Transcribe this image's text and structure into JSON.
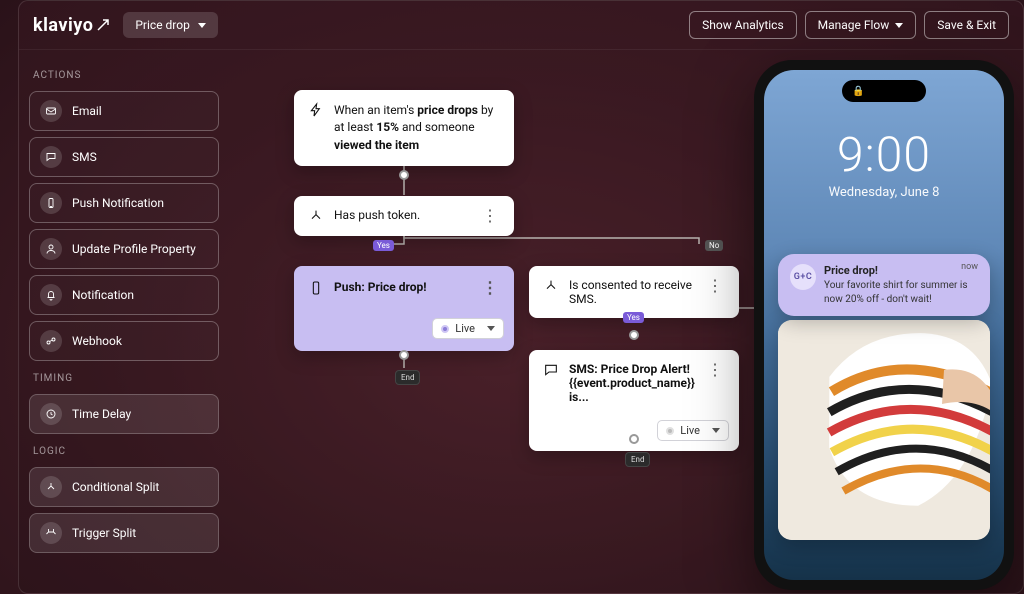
{
  "brand": "klaviyo",
  "flow_picker": {
    "label": "Price drop"
  },
  "header_buttons": {
    "analytics": "Show Analytics",
    "manage": "Manage Flow",
    "save": "Save & Exit"
  },
  "sidebar": {
    "sections": {
      "actions": "ACTIONS",
      "timing": "TIMING",
      "logic": "LOGIC"
    },
    "actions": [
      {
        "label": "Email",
        "icon": "mail-icon"
      },
      {
        "label": "SMS",
        "icon": "chat-icon"
      },
      {
        "label": "Push Notification",
        "icon": "phone-icon"
      },
      {
        "label": "Update Profile Property",
        "icon": "user-icon"
      },
      {
        "label": "Notification",
        "icon": "bell-icon"
      },
      {
        "label": "Webhook",
        "icon": "link-icon"
      }
    ],
    "timing": [
      {
        "label": "Time Delay",
        "icon": "clock-icon"
      }
    ],
    "logic": [
      {
        "label": "Conditional Split",
        "icon": "split-icon"
      },
      {
        "label": "Trigger Split",
        "icon": "trigger-split-icon"
      }
    ]
  },
  "canvas": {
    "trigger": {
      "prefix": "When an item's ",
      "bold1": "price drops",
      "mid": " by at least ",
      "bold2": "15%",
      "mid2": " and someone ",
      "bold3": "viewed the item"
    },
    "cond_push": {
      "text": "Has push token."
    },
    "push": {
      "title": "Push: Price drop!",
      "status": "Live"
    },
    "cond_sms": {
      "text": "Is consented to receive SMS."
    },
    "sms": {
      "line1": "SMS: Price Drop Alert!",
      "line2": "{{event.product_name}} is...",
      "status": "Live"
    },
    "branch": {
      "yes": "Yes",
      "no": "No"
    },
    "end": "End"
  },
  "phone": {
    "time": "9:00",
    "date": "Wednesday, June 8",
    "notif": {
      "app_initials": "G+C",
      "title": "Price drop!",
      "body": "Your favorite shirt for summer is now 20% off - don't wait!",
      "when": "now"
    }
  }
}
